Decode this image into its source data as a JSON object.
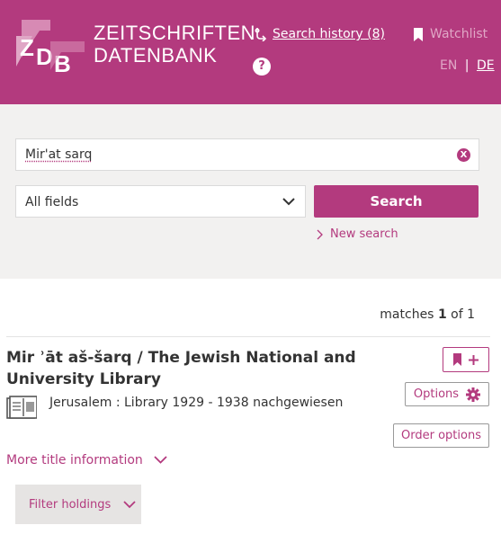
{
  "header": {
    "brand_line1": "ZEITSCHRIFTEN",
    "brand_line2": "DATENBANK",
    "search_history_label": "Search history (8)",
    "help_label": "?",
    "watchlist_label": "Watchlist",
    "lang_en": "EN",
    "lang_sep": "|",
    "lang_de": "DE"
  },
  "search": {
    "query_value": "Mir'at sarq",
    "clear_label": "X",
    "field_selected": "All fields",
    "button_label": "Search",
    "new_search_label": "New search"
  },
  "results": {
    "matches_prefix": "matches ",
    "matches_current": "1",
    "matches_suffix": " of 1",
    "items": [
      {
        "title": "Mir ʾāt aš-šarq / The Jewish National and University Library",
        "holding": "Jerusalem : Library 1929 - 1938 nachgewiesen",
        "options_label": "Options",
        "order_label": "Order options",
        "more_info_label": "More title information",
        "filter_label": "Filter holdings"
      }
    ]
  },
  "colors": {
    "brand": "#b33a7e",
    "panel_bg": "#f2f1f0",
    "muted_pink": "#e0a7c6"
  }
}
